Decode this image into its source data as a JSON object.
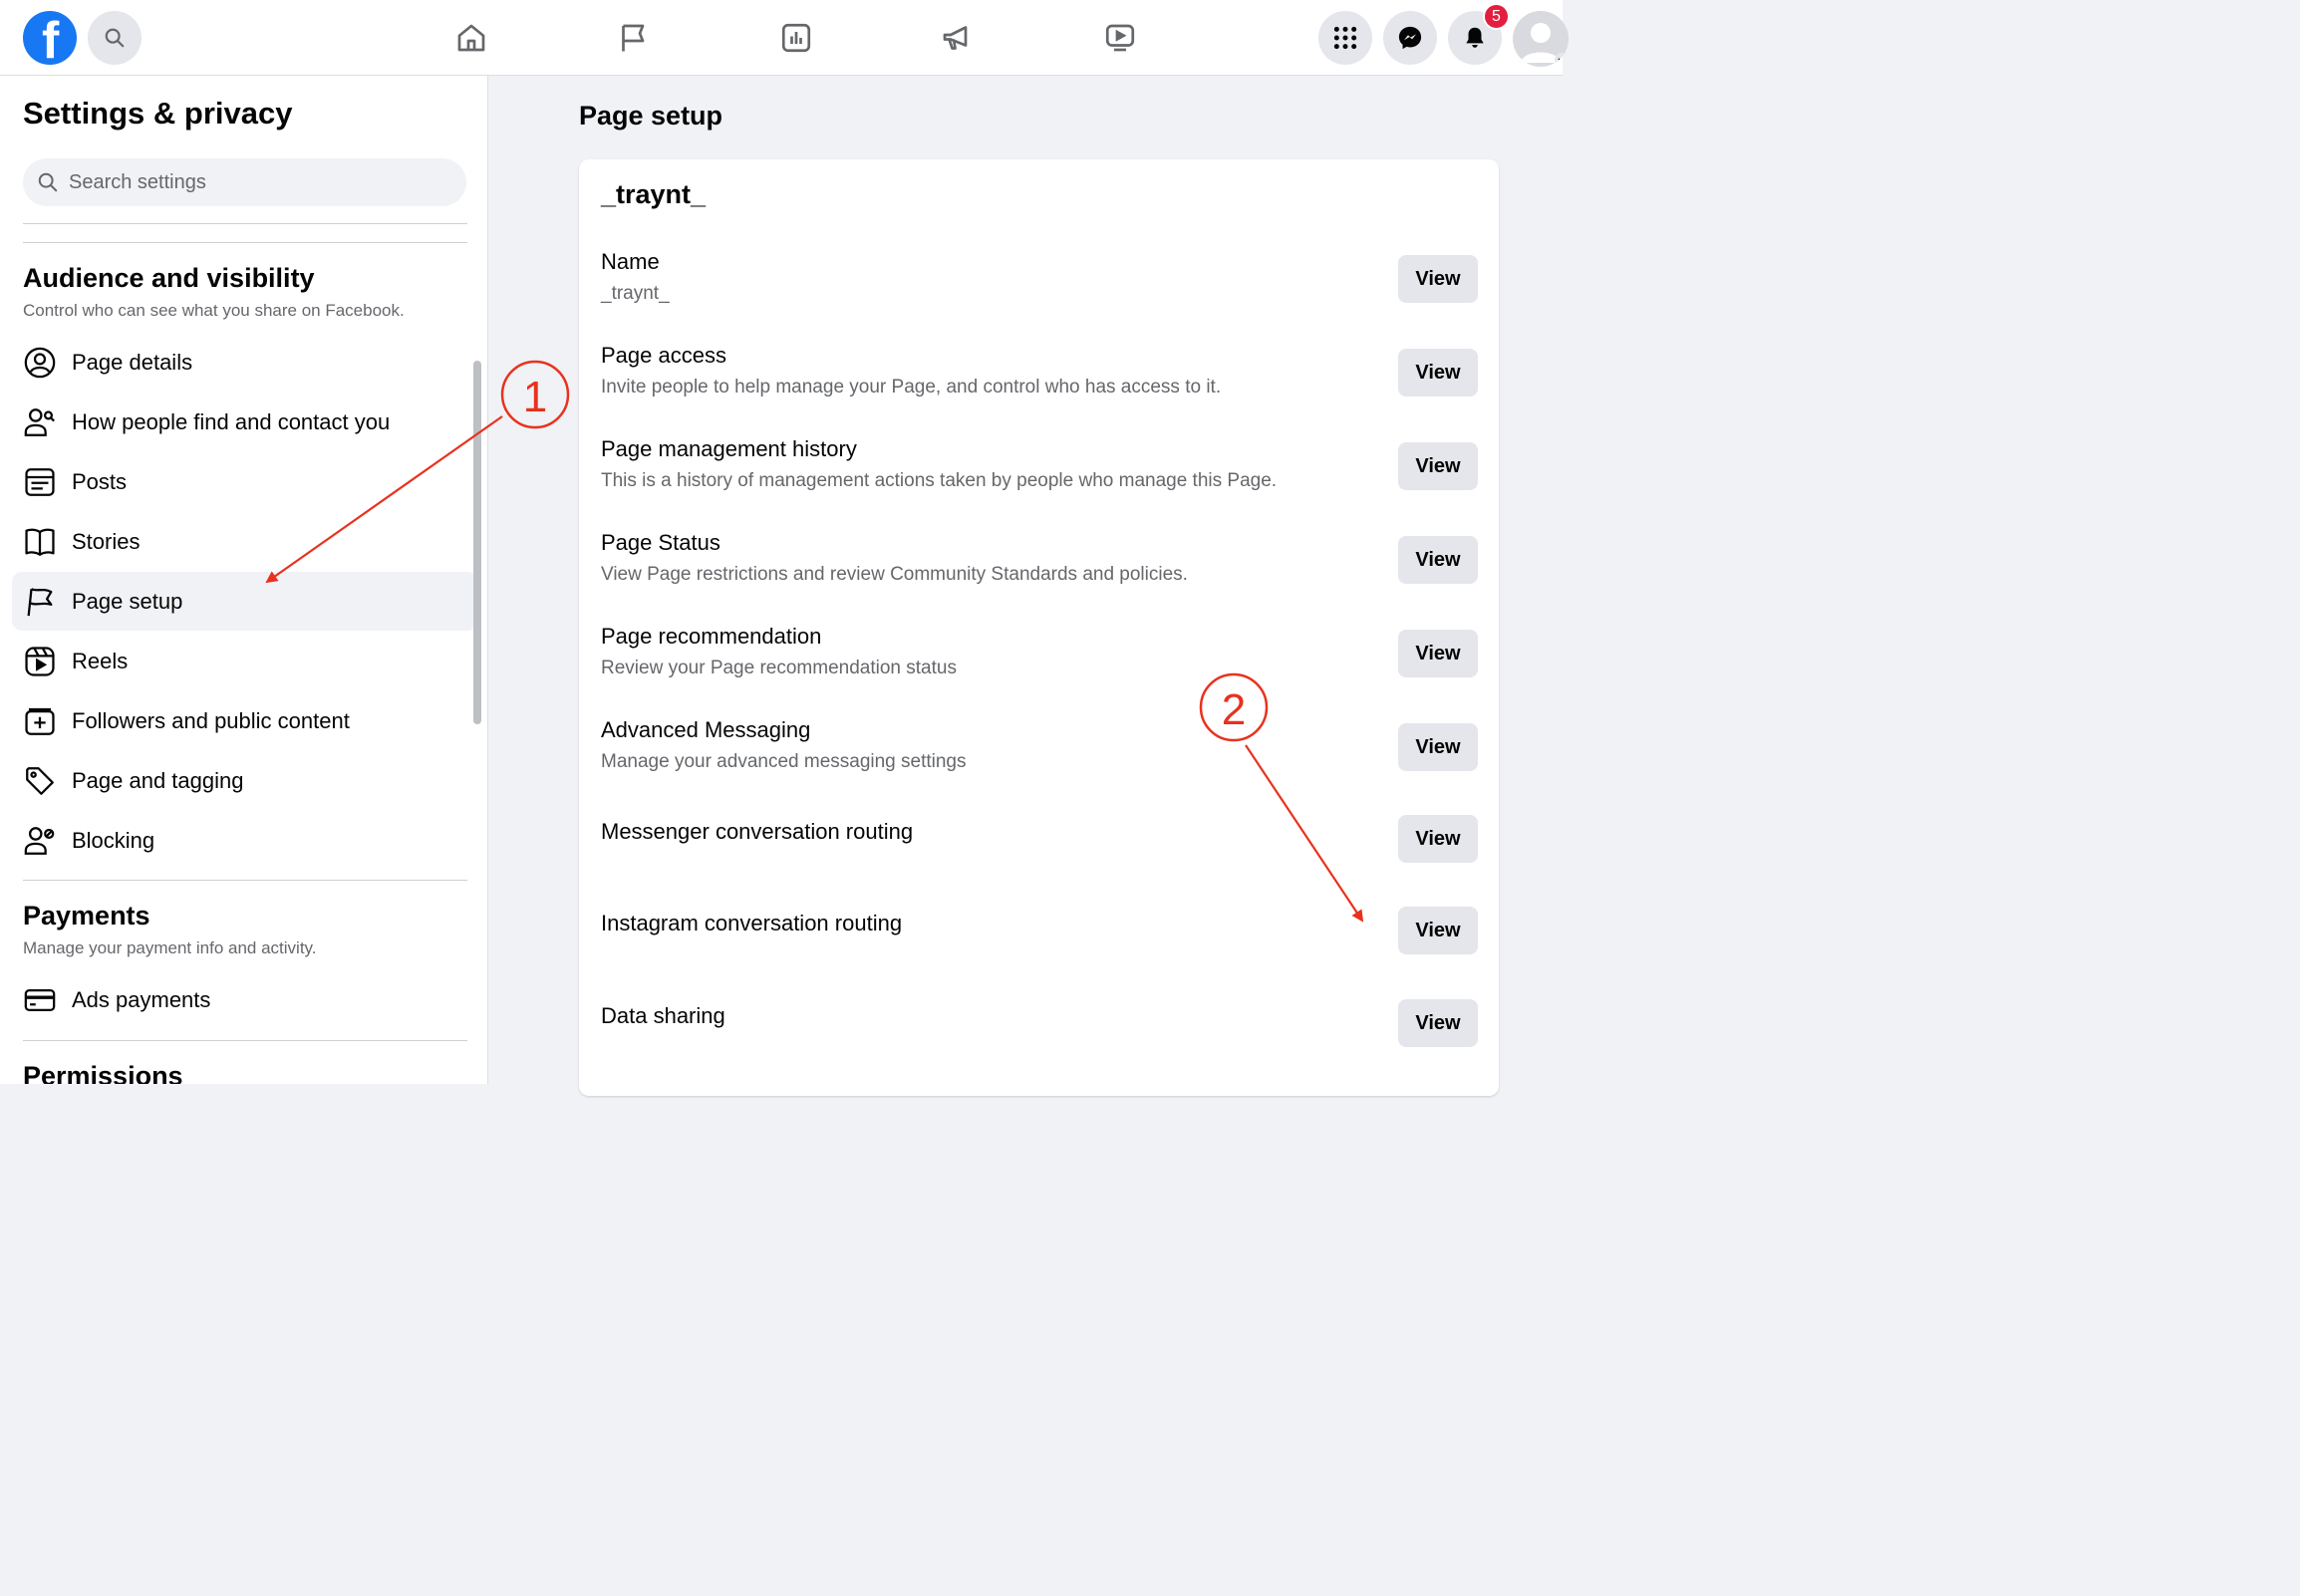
{
  "topbar": {
    "logo": "f",
    "icons": [
      "search-icon",
      "home-icon",
      "flag-icon",
      "insights-icon",
      "megaphone-icon",
      "video-icon",
      "menu-grid-icon",
      "messenger-icon",
      "bell-icon",
      "profile-avatar"
    ],
    "notifications_count": "5"
  },
  "sidebar": {
    "title": "Settings & privacy",
    "search_placeholder": "Search settings",
    "audience": {
      "title": "Audience and visibility",
      "subtitle": "Control who can see what you share on Facebook.",
      "items": [
        {
          "label": "Page details",
          "icon": "user-circle-icon"
        },
        {
          "label": "How people find and contact you",
          "icon": "user-search-icon"
        },
        {
          "label": "Posts",
          "icon": "posts-icon"
        },
        {
          "label": "Stories",
          "icon": "book-icon"
        },
        {
          "label": "Page setup",
          "icon": "flag-icon",
          "active": true
        },
        {
          "label": "Reels",
          "icon": "reels-icon"
        },
        {
          "label": "Followers and public content",
          "icon": "followers-icon"
        },
        {
          "label": "Page and tagging",
          "icon": "tag-icon"
        },
        {
          "label": "Blocking",
          "icon": "block-user-icon"
        }
      ]
    },
    "payments": {
      "title": "Payments",
      "subtitle": "Manage your payment info and activity.",
      "items": [
        {
          "label": "Ads payments",
          "icon": "credit-card-icon"
        }
      ]
    },
    "permissions": {
      "title": "Permissions"
    }
  },
  "main": {
    "title": "Page setup",
    "card_title": "_traynt_",
    "rows": [
      {
        "title": "Name",
        "subtitle": "_traynt_",
        "button": "View"
      },
      {
        "title": "Page access",
        "subtitle": "Invite people to help manage your Page, and control who has access to it.",
        "button": "View"
      },
      {
        "title": "Page management history",
        "subtitle": "This is a history of management actions taken by people who manage this Page.",
        "button": "View"
      },
      {
        "title": "Page Status",
        "subtitle": "View Page restrictions and review Community Standards and policies.",
        "button": "View"
      },
      {
        "title": "Page recommendation",
        "subtitle": "Review your Page recommendation status",
        "button": "View"
      },
      {
        "title": "Advanced Messaging",
        "subtitle": "Manage your advanced messaging settings",
        "button": "View"
      },
      {
        "title": "Messenger conversation routing",
        "subtitle": "",
        "button": "View"
      },
      {
        "title": "Instagram conversation routing",
        "subtitle": "",
        "button": "View"
      },
      {
        "title": "Data sharing",
        "subtitle": "",
        "button": "View"
      }
    ]
  },
  "annotations": {
    "marker1": "1",
    "marker2": "2",
    "color": "#e8321e"
  }
}
